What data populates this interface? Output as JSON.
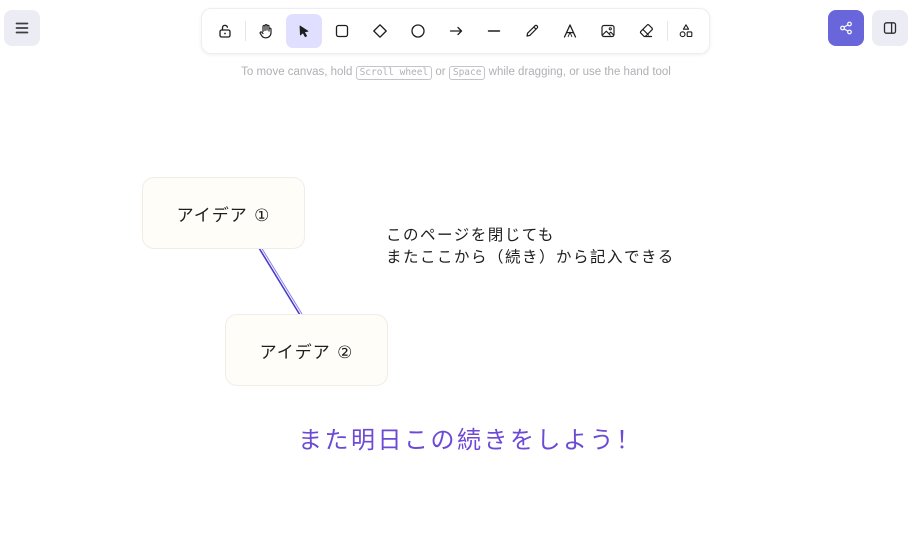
{
  "toolbar": {
    "tools": [
      {
        "name": "lock",
        "icon": "unlock-icon"
      },
      {
        "name": "hand",
        "icon": "hand-icon"
      },
      {
        "name": "selection",
        "icon": "pointer-icon",
        "active": true
      },
      {
        "name": "rectangle",
        "icon": "square-icon"
      },
      {
        "name": "diamond",
        "icon": "diamond-icon"
      },
      {
        "name": "ellipse",
        "icon": "circle-icon"
      },
      {
        "name": "arrow",
        "icon": "arrow-right-icon"
      },
      {
        "name": "line",
        "icon": "line-icon"
      },
      {
        "name": "draw",
        "icon": "pencil-icon"
      },
      {
        "name": "text",
        "icon": "text-icon"
      },
      {
        "name": "image",
        "icon": "image-icon"
      },
      {
        "name": "eraser",
        "icon": "eraser-icon"
      },
      {
        "name": "extra-tools",
        "icon": "shapes-icon"
      }
    ]
  },
  "hint": {
    "prefix": "To move canvas, hold",
    "key_1": "Scroll wheel",
    "middle": "or",
    "key_2": "Space",
    "suffix": "while dragging, or use the hand tool"
  },
  "canvas": {
    "card_1": "アイデア ①",
    "card_2": "アイデア ②",
    "note_line_1": "このページを閉じても",
    "note_line_2": "またここから（続き）から記入できる",
    "headline": "また明日この続きをしよう！"
  },
  "colors": {
    "accent": "#6965db",
    "headline": "#6c4ad6",
    "active_tool_bg": "#e0dfff",
    "connector": "#4a3ccf"
  }
}
